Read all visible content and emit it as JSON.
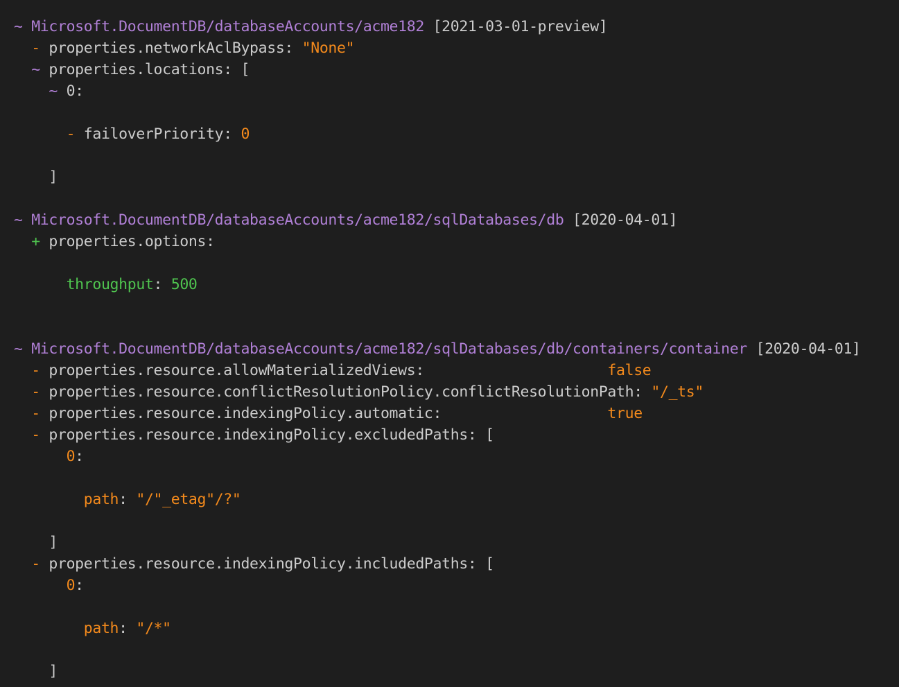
{
  "colors": {
    "background": "#1e1e1e",
    "text": "#cccccc",
    "resource": "#b180d7",
    "removed": "#f48a1c",
    "added": "#4fc44f"
  },
  "lines": [
    {
      "name": "resource-header-account",
      "interactable": false,
      "segs": [
        {
          "t": "~ ",
          "c": "resource"
        },
        {
          "t": "Microsoft.DocumentDB/databaseAccounts/acme182",
          "c": "resource"
        },
        {
          "t": " [2021-03-01-preview]",
          "c": "text"
        }
      ]
    },
    {
      "name": "change-line-removed",
      "interactable": false,
      "segs": [
        {
          "t": "  - ",
          "c": "removed"
        },
        {
          "t": "properties.networkAclBypass: ",
          "c": "text"
        },
        {
          "t": "\"None\"",
          "c": "removed"
        }
      ]
    },
    {
      "name": "change-line-modified",
      "interactable": false,
      "segs": [
        {
          "t": "  ~ ",
          "c": "resource"
        },
        {
          "t": "properties.locations: [",
          "c": "text"
        }
      ]
    },
    {
      "name": "array-index-line",
      "interactable": false,
      "segs": [
        {
          "t": "    ~ ",
          "c": "resource"
        },
        {
          "t": "0:",
          "c": "text"
        }
      ]
    },
    {
      "name": "blank-line",
      "segs": []
    },
    {
      "name": "change-line-removed",
      "interactable": false,
      "segs": [
        {
          "t": "      - ",
          "c": "removed"
        },
        {
          "t": "failoverPriority: ",
          "c": "text"
        },
        {
          "t": "0",
          "c": "removed"
        }
      ]
    },
    {
      "name": "blank-line",
      "segs": []
    },
    {
      "name": "array-close-line",
      "interactable": false,
      "segs": [
        {
          "t": "    ]",
          "c": "text"
        }
      ]
    },
    {
      "name": "blank-line",
      "segs": []
    },
    {
      "name": "resource-header-sql-database",
      "interactable": false,
      "segs": [
        {
          "t": "~ ",
          "c": "resource"
        },
        {
          "t": "Microsoft.DocumentDB/databaseAccounts/acme182/sqlDatabases/db",
          "c": "resource"
        },
        {
          "t": " [2020-04-01]",
          "c": "text"
        }
      ]
    },
    {
      "name": "change-line-added",
      "interactable": false,
      "segs": [
        {
          "t": "  + ",
          "c": "added"
        },
        {
          "t": "properties.options:",
          "c": "text"
        }
      ]
    },
    {
      "name": "blank-line",
      "segs": []
    },
    {
      "name": "added-property-line",
      "interactable": false,
      "segs": [
        {
          "t": "      throughput",
          "c": "added"
        },
        {
          "t": ": ",
          "c": "text"
        },
        {
          "t": "500",
          "c": "added"
        }
      ]
    },
    {
      "name": "blank-line",
      "segs": []
    },
    {
      "name": "blank-line",
      "segs": []
    },
    {
      "name": "resource-header-container",
      "interactable": false,
      "segs": [
        {
          "t": "~ ",
          "c": "resource"
        },
        {
          "t": "Microsoft.DocumentDB/databaseAccounts/acme182/sqlDatabases/db/containers/container",
          "c": "resource"
        },
        {
          "t": " [2020-04-01]",
          "c": "text"
        }
      ]
    },
    {
      "name": "change-line-removed",
      "interactable": false,
      "segs": [
        {
          "t": "  - ",
          "c": "removed"
        },
        {
          "t": "properties.resource.allowMaterializedViews:                     ",
          "c": "text"
        },
        {
          "t": "false",
          "c": "removed"
        }
      ]
    },
    {
      "name": "change-line-removed",
      "interactable": false,
      "segs": [
        {
          "t": "  - ",
          "c": "removed"
        },
        {
          "t": "properties.resource.conflictResolutionPolicy.conflictResolutionPath: ",
          "c": "text"
        },
        {
          "t": "\"/_ts\"",
          "c": "removed"
        }
      ]
    },
    {
      "name": "change-line-removed",
      "interactable": false,
      "segs": [
        {
          "t": "  - ",
          "c": "removed"
        },
        {
          "t": "properties.resource.indexingPolicy.automatic:                   ",
          "c": "text"
        },
        {
          "t": "true",
          "c": "removed"
        }
      ]
    },
    {
      "name": "change-line-removed",
      "interactable": false,
      "segs": [
        {
          "t": "  - ",
          "c": "removed"
        },
        {
          "t": "properties.resource.indexingPolicy.excludedPaths: [",
          "c": "text"
        }
      ]
    },
    {
      "name": "array-index-line",
      "interactable": false,
      "segs": [
        {
          "t": "      0",
          "c": "removed"
        },
        {
          "t": ":",
          "c": "text"
        }
      ]
    },
    {
      "name": "blank-line",
      "segs": []
    },
    {
      "name": "removed-property-line",
      "interactable": false,
      "segs": [
        {
          "t": "        path",
          "c": "removed"
        },
        {
          "t": ": ",
          "c": "text"
        },
        {
          "t": "\"/\"_etag\"/?\"",
          "c": "removed"
        }
      ]
    },
    {
      "name": "blank-line",
      "segs": []
    },
    {
      "name": "array-close-line",
      "interactable": false,
      "segs": [
        {
          "t": "    ]",
          "c": "text"
        }
      ]
    },
    {
      "name": "change-line-removed",
      "interactable": false,
      "segs": [
        {
          "t": "  - ",
          "c": "removed"
        },
        {
          "t": "properties.resource.indexingPolicy.includedPaths: [",
          "c": "text"
        }
      ]
    },
    {
      "name": "array-index-line",
      "interactable": false,
      "segs": [
        {
          "t": "      0",
          "c": "removed"
        },
        {
          "t": ":",
          "c": "text"
        }
      ]
    },
    {
      "name": "blank-line",
      "segs": []
    },
    {
      "name": "removed-property-line",
      "interactable": false,
      "segs": [
        {
          "t": "        path",
          "c": "removed"
        },
        {
          "t": ": ",
          "c": "text"
        },
        {
          "t": "\"/*\"",
          "c": "removed"
        }
      ]
    },
    {
      "name": "blank-line",
      "segs": []
    },
    {
      "name": "array-close-line",
      "interactable": false,
      "segs": [
        {
          "t": "    ]",
          "c": "text"
        }
      ]
    }
  ]
}
